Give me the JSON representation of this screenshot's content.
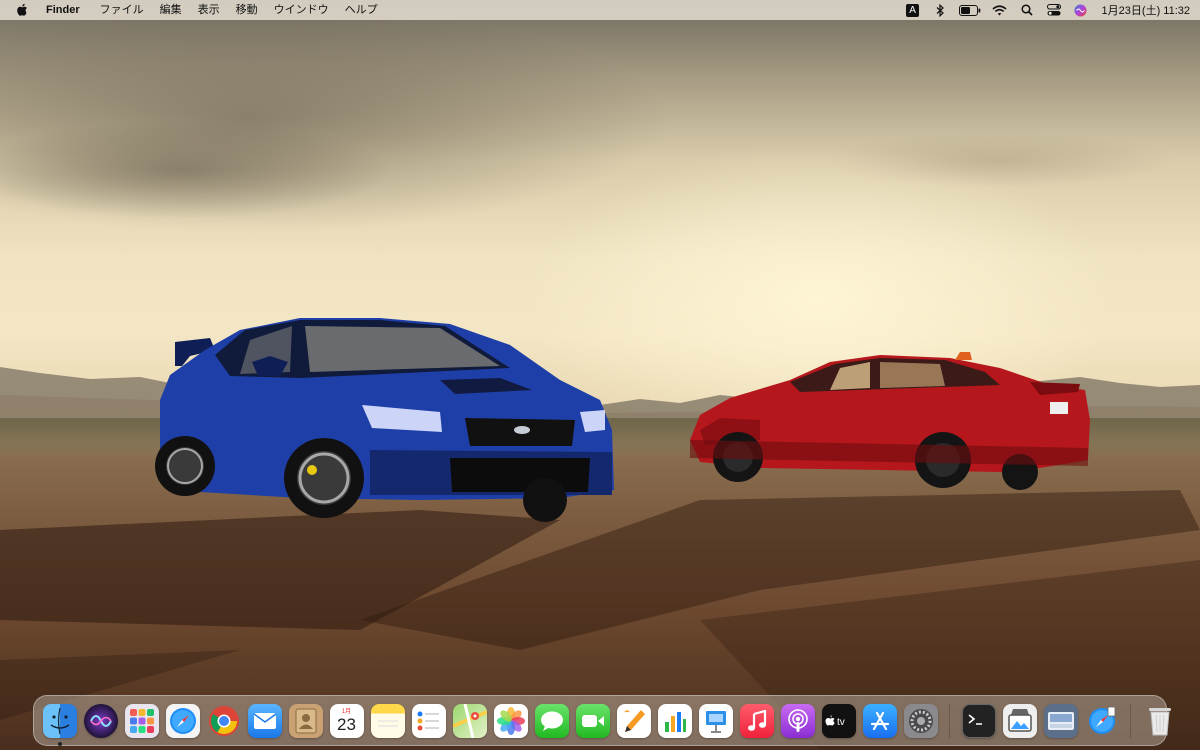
{
  "menubar": {
    "app_name": "Finder",
    "menus": [
      "ファイル",
      "編集",
      "表示",
      "移動",
      "ウインドウ",
      "ヘルプ"
    ],
    "input_source": "A",
    "clock": "1月23日(土)  11:32"
  },
  "dock": {
    "calendar": {
      "month": "1月",
      "day": "23"
    },
    "apps": [
      {
        "name": "Finder",
        "icon": "finder-icon",
        "running": true
      },
      {
        "name": "Siri",
        "icon": "siri-icon"
      },
      {
        "name": "Launchpad",
        "icon": "launchpad-icon"
      },
      {
        "name": "Safari",
        "icon": "safari-icon"
      },
      {
        "name": "Google Chrome",
        "icon": "chrome-icon"
      },
      {
        "name": "Mail",
        "icon": "mail-icon"
      },
      {
        "name": "Contacts",
        "icon": "contacts-icon"
      },
      {
        "name": "Calendar",
        "icon": "calendar-icon"
      },
      {
        "name": "Notes",
        "icon": "notes-icon"
      },
      {
        "name": "Reminders",
        "icon": "reminders-icon"
      },
      {
        "name": "Maps",
        "icon": "maps-icon"
      },
      {
        "name": "Photos",
        "icon": "photos-icon"
      },
      {
        "name": "Messages",
        "icon": "messages-icon"
      },
      {
        "name": "FaceTime",
        "icon": "facetime-icon"
      },
      {
        "name": "Pages",
        "icon": "pages-icon"
      },
      {
        "name": "Numbers",
        "icon": "numbers-icon"
      },
      {
        "name": "Keynote",
        "icon": "keynote-icon"
      },
      {
        "name": "Music",
        "icon": "music-icon"
      },
      {
        "name": "Podcasts",
        "icon": "podcasts-icon"
      },
      {
        "name": "TV",
        "icon": "tv-icon"
      },
      {
        "name": "App Store",
        "icon": "app-store-icon"
      },
      {
        "name": "System Preferences",
        "icon": "system-preferences-icon"
      },
      {
        "name": "Terminal",
        "icon": "terminal-icon"
      },
      {
        "name": "Preview",
        "icon": "preview-icon"
      },
      {
        "name": "Safari Document",
        "icon": "safari-document-icon"
      },
      {
        "name": "Trash",
        "icon": "trash-icon"
      }
    ]
  },
  "colors": {
    "menubar_bg": "#e8e1d4",
    "blue_car": "#1f3fa8",
    "red_car": "#b5171c"
  }
}
